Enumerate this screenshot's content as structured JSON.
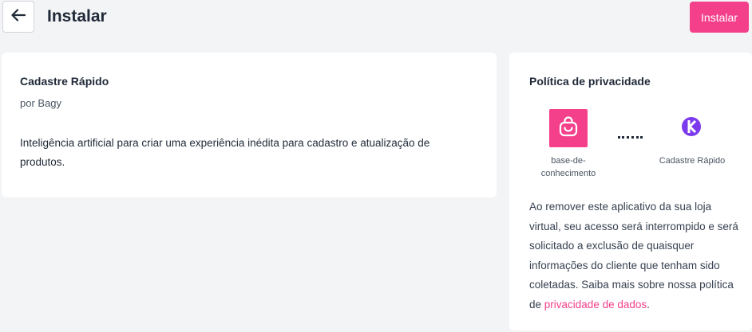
{
  "header": {
    "title": "Instalar",
    "install_label": "Instalar"
  },
  "app": {
    "name": "Cadastre Rápido",
    "author": "por Bagy",
    "description": "Inteligência artificial para criar uma experiência inédita para cadastro e atualização de produtos."
  },
  "privacy": {
    "title": "Política de privacidade",
    "left_label": "base-de-conhecimento",
    "right_label": "Cadastre Rápido",
    "text_before_link": "Ao remover este aplicativo da sua loja virtual, seu acesso será interrompido e será solicitado a exclusão de quaisquer informações do cliente que tenham sido coletadas. Saiba mais sobre nossa política de ",
    "link_text": "privacidade de dados",
    "text_after_link": "."
  },
  "icons": {
    "back": "arrow-left-icon",
    "store": "shopping-bag-icon",
    "partner": "cadastre-rapido-logo-icon"
  },
  "colors": {
    "accent": "#f43f8b",
    "partner_logo": "#7c3aed",
    "background": "#f3f4f6"
  }
}
